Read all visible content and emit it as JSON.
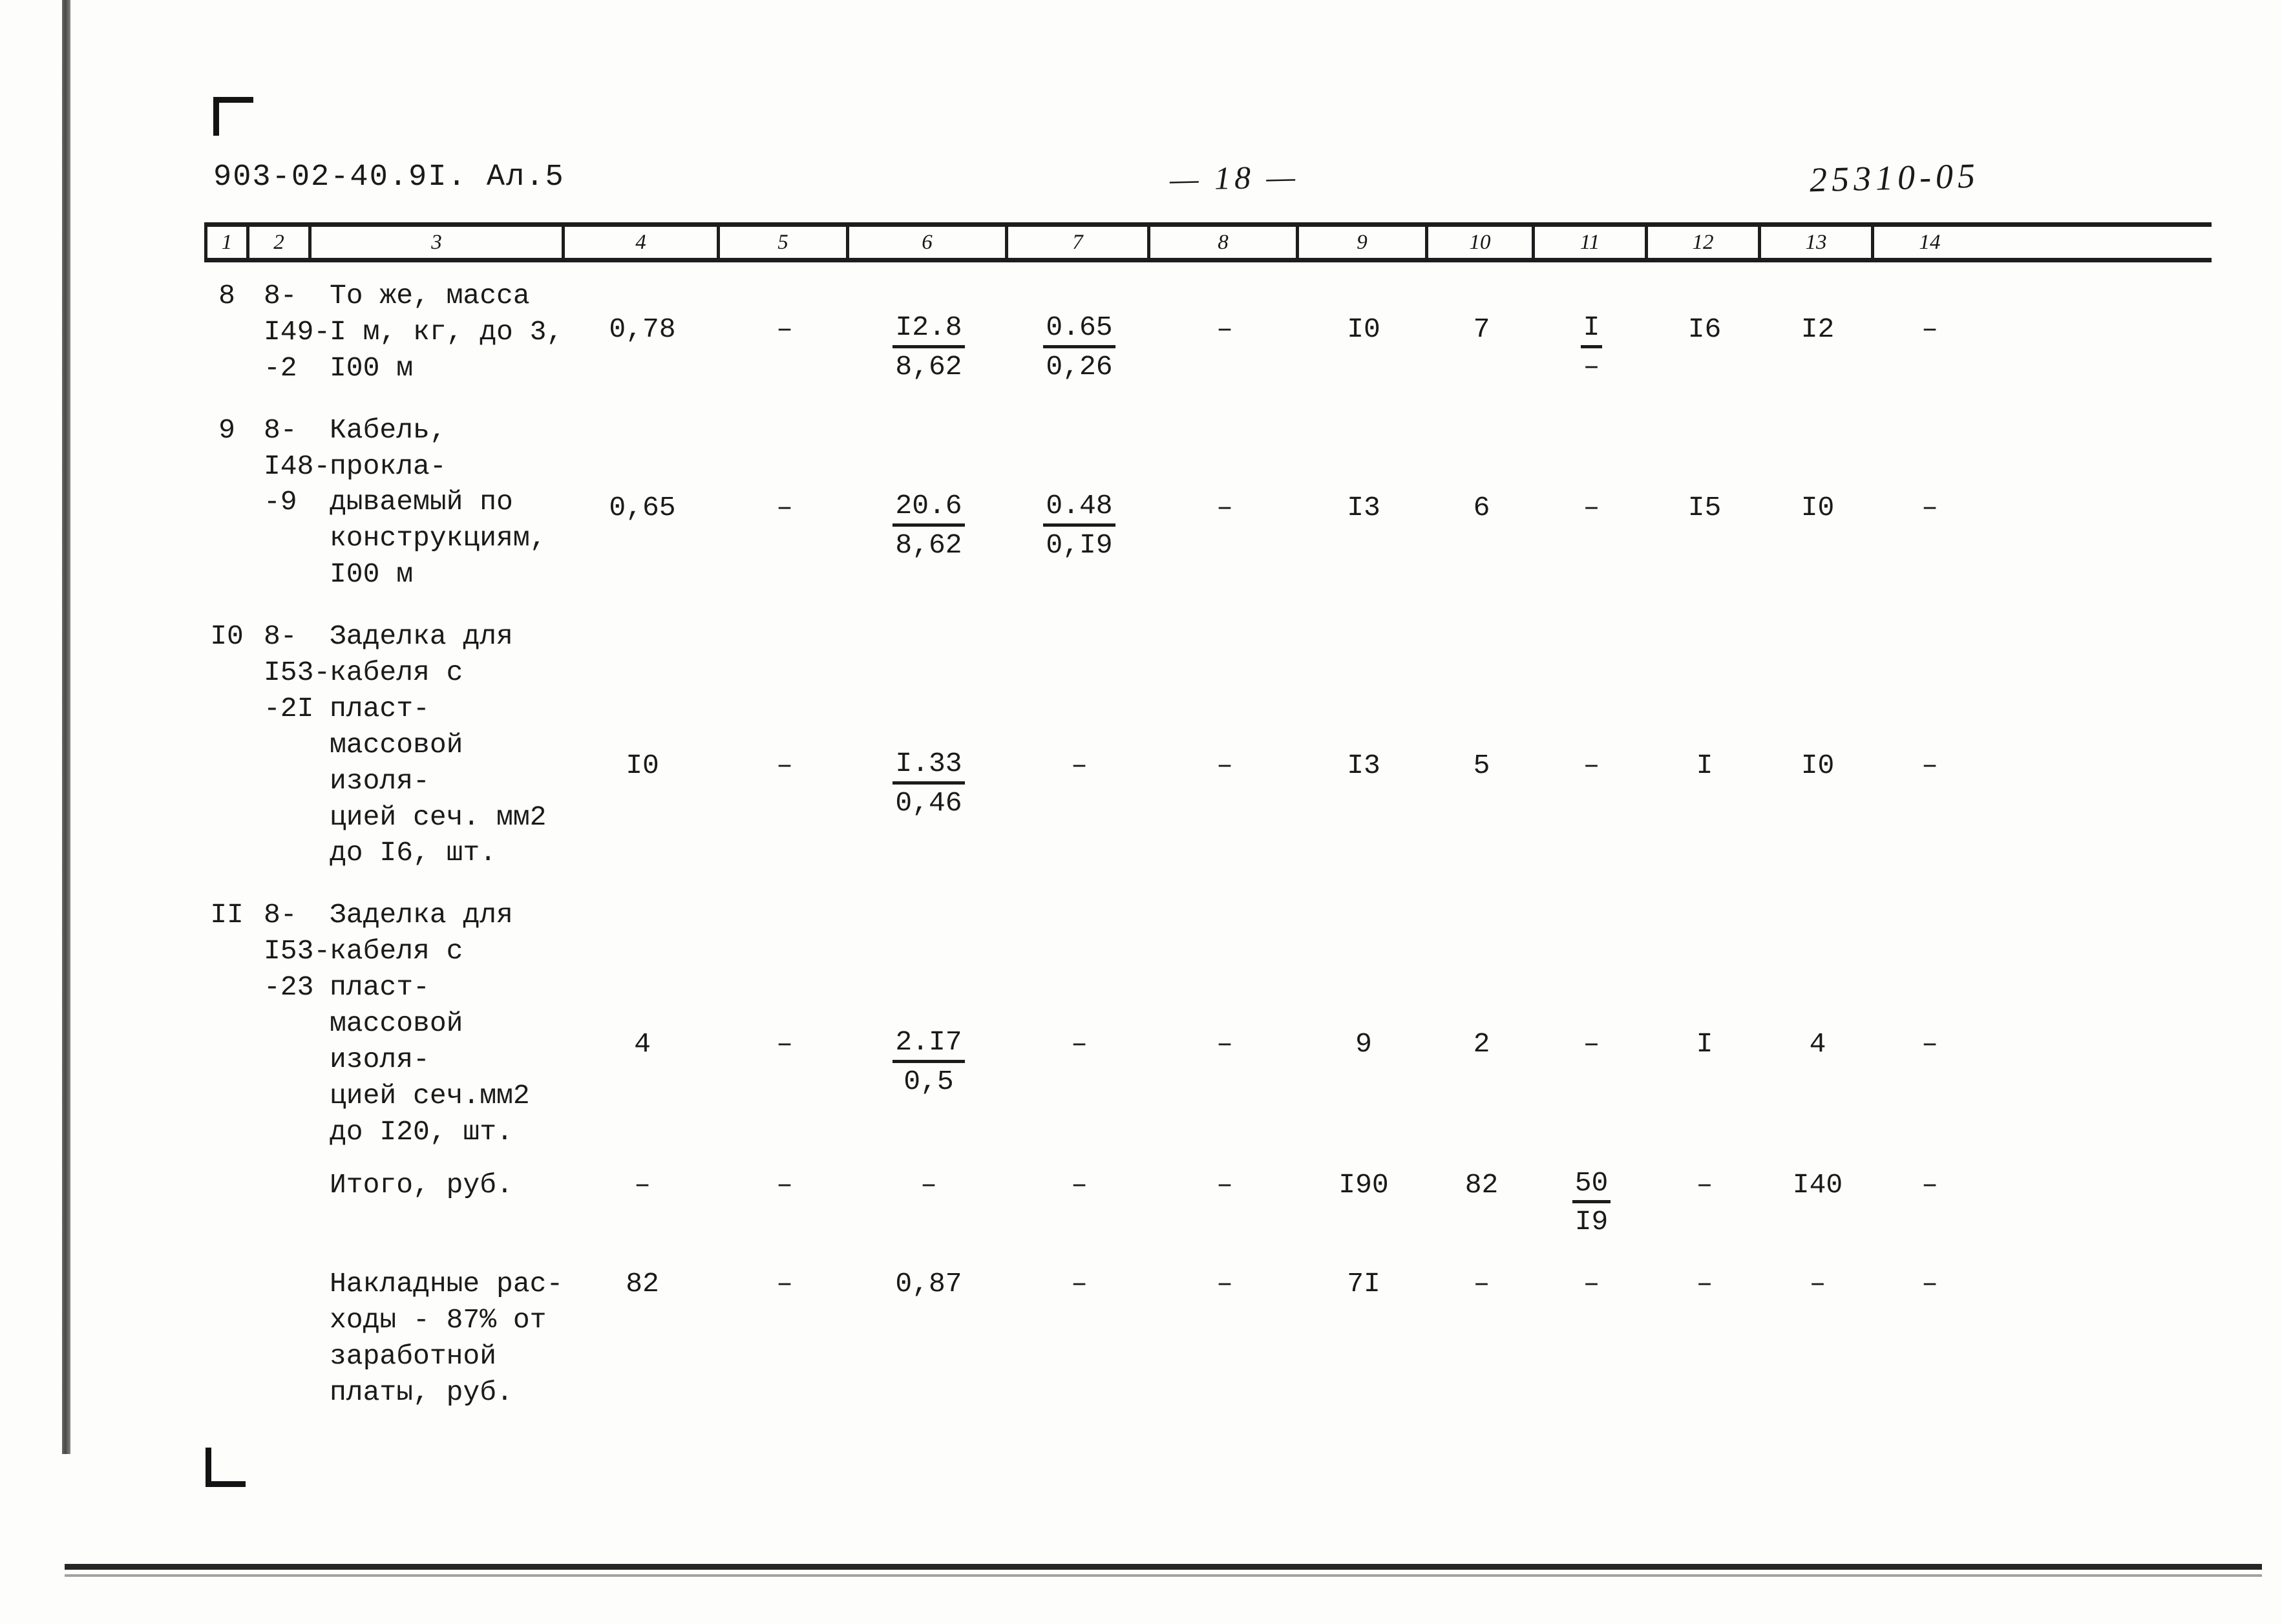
{
  "header": {
    "doc_code": "903-02-40.9I. Ал.5",
    "page_marker": "— 18 —",
    "sheet_code": "25310-05"
  },
  "table": {
    "column_numbers": [
      "1",
      "2",
      "3",
      "4",
      "5",
      "6",
      "7",
      "8",
      "9",
      "10",
      "11",
      "12",
      "13",
      "14"
    ],
    "rows": [
      {
        "num": "8",
        "code": "8-I49-\n-2",
        "desc": "То же, масса\nI м, кг, до 3,\n          I00 м",
        "c4": "0,78",
        "c5": "–",
        "c6_top": "I2.8",
        "c6_bot": "8,62",
        "c7_top": "0.65",
        "c7_bot": "0,26",
        "c8": "–",
        "c9": "I0",
        "c10": "7",
        "c11_top": "I",
        "c11_bot": "–",
        "c12": "I6",
        "c13": "I2",
        "c14": "–"
      },
      {
        "num": "9",
        "code": "8-I48-\n-9",
        "desc": "Кабель, прокла-\nдываемый по\nконструкциям,\n         I00 м",
        "c4": "0,65",
        "c5": "–",
        "c6_top": "20.6",
        "c6_bot": "8,62",
        "c7_top": "0.48",
        "c7_bot": "0,I9",
        "c8": "–",
        "c9": "I3",
        "c10": "6",
        "c11": "–",
        "c12": "I5",
        "c13": "I0",
        "c14": "–"
      },
      {
        "num": "I0",
        "code": "8-I53-\n-2I",
        "desc": "Заделка для\nкабеля с пласт-\nмассовой изоля-\nцией сеч. мм2\nдо I6,  шт.",
        "c4": "I0",
        "c5": "–",
        "c6_top": "I.33",
        "c6_bot": "0,46",
        "c7": "–",
        "c8": "–",
        "c9": "I3",
        "c10": "5",
        "c11": "–",
        "c12": "I",
        "c13": "I0",
        "c14": "–"
      },
      {
        "num": "II",
        "code": "8-I53-\n-23",
        "desc": "Заделка для\nкабеля с пласт-\nмассовой изоля-\nцией сеч.мм2\nдо I20,  шт.",
        "c4": "4",
        "c5": "–",
        "c6_top": "2.I7",
        "c6_bot": "0,5",
        "c7": "–",
        "c8": "–",
        "c9": "9",
        "c10": "2",
        "c11": "–",
        "c12": "I",
        "c13": "4",
        "c14": "–"
      },
      {
        "num": "",
        "code": "",
        "desc": "Итого,   руб.",
        "c4": "–",
        "c5": "–",
        "c6": "–",
        "c7": "–",
        "c8": "–",
        "c9": "I90",
        "c10": "82",
        "c11_top": "50",
        "c11_bot": "I9",
        "c12": "–",
        "c13": "I40",
        "c14": "–"
      },
      {
        "num": "",
        "code": "",
        "desc": "Накладные рас-\nходы - 87% от\nзаработной\nплаты,   руб.",
        "c4": "82",
        "c5": "–",
        "c6": "0,87",
        "c7": "–",
        "c8": "–",
        "c9": "7I",
        "c10": "–",
        "c11": "–",
        "c12": "–",
        "c13": "–",
        "c14": "–"
      }
    ]
  }
}
